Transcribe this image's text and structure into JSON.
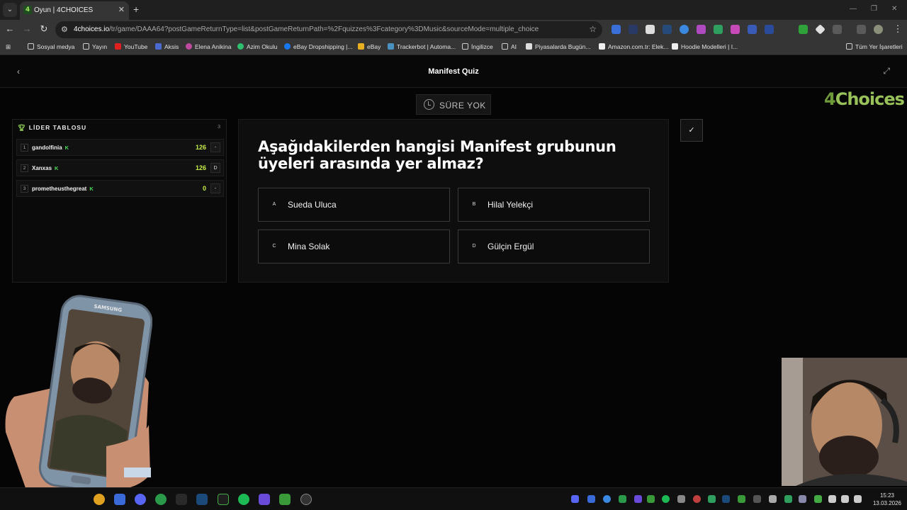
{
  "browser": {
    "tab_title": "Oyun | 4CHOICES",
    "tab_favicon": "4",
    "url_host": "4choices.io",
    "url_path": "/tr/game/DAAA64?postGameReturnType=list&postGameReturnPath=%2Fquizzes%3Fcategory%3DMusic&sourceMode=multiple_choice",
    "bookmarks": [
      "Sosyal medya",
      "Yayın",
      "YouTube",
      "Aksis",
      "Elena Anikina",
      "Azim Okulu",
      "eBay Dropshipping |...",
      "eBay",
      "Trackerbot | Automa...",
      "İngilizce",
      "AI",
      "Piyasalarda Bugün...",
      "Amazon.com.tr: Elek...",
      "Hoodie Modelleri | I..."
    ],
    "bookmarks_all": "Tüm Yer İşaretleri"
  },
  "app": {
    "title": "Manifest Quiz",
    "timer": "SÜRE YOK",
    "logo_a": "4",
    "logo_b": "Choices"
  },
  "leaderboard": {
    "heading": "LİDER TABLOSU",
    "count": "3",
    "players": [
      {
        "rank": "1",
        "name": "gandolfinia",
        "badge": "K",
        "score": "126",
        "answer": "-"
      },
      {
        "rank": "2",
        "name": "Xanxas",
        "badge": "K",
        "score": "126",
        "answer": "D"
      },
      {
        "rank": "3",
        "name": "prometheusthegreat",
        "badge": "K",
        "score": "0",
        "answer": "-"
      }
    ]
  },
  "question": {
    "text": "Aşağıdakilerden hangisi Manifest grubunun üyeleri arasında yer almaz?",
    "options": [
      {
        "key": "A",
        "label": "Sueda Uluca"
      },
      {
        "key": "B",
        "label": "Hilal Yelekçi"
      },
      {
        "key": "C",
        "label": "Mina Solak"
      },
      {
        "key": "D",
        "label": "Gülçin Ergül"
      }
    ]
  },
  "overlay": {
    "phone_brand": "SAMSUNG"
  },
  "taskbar": {
    "time": "15:23",
    "date": "13.03.2026"
  },
  "colors": {
    "accent_green": "#9be15d",
    "score_yellow": "#c7ef4a"
  }
}
